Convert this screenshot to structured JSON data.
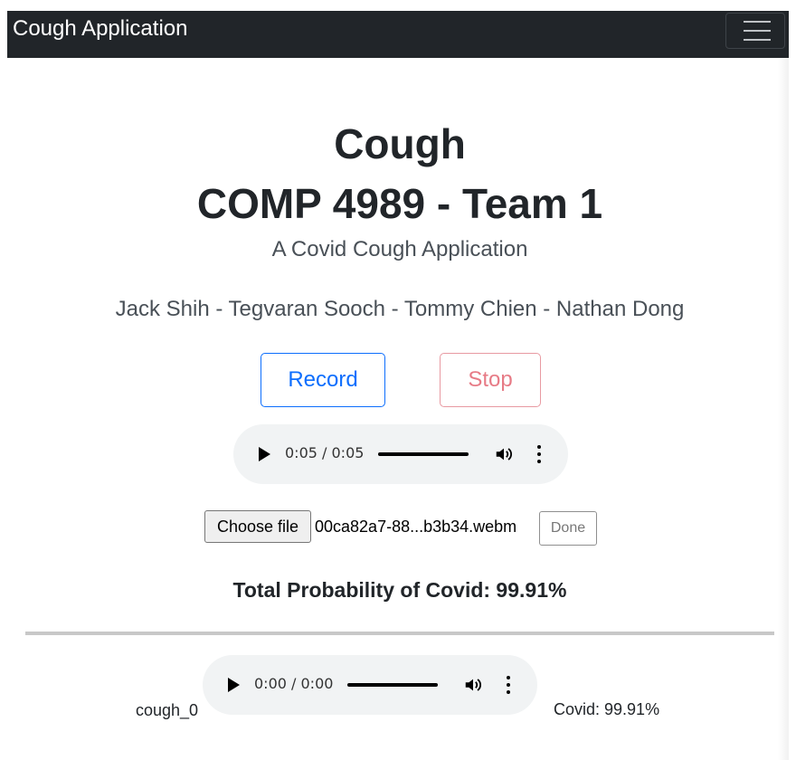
{
  "navbar": {
    "brand": "Cough Application",
    "menu_icon": "hamburger-menu-icon"
  },
  "header": {
    "title_line1": "Cough",
    "title_line2": "COMP 4989 - Team 1",
    "subtitle": "A Covid Cough Application",
    "members": "Jack Shih - Tegvaran Sooch - Tommy Chien - Nathan Dong"
  },
  "controls": {
    "record_label": "Record",
    "stop_label": "Stop",
    "record_color": "#0d6efd",
    "stop_color": "#e77b86"
  },
  "main_audio": {
    "time": "0:05 / 0:05",
    "progress": 1.0
  },
  "file": {
    "choose_label": "Choose file",
    "filename": "00ca82a7-88...b3b34.webm",
    "done_label": "Done"
  },
  "result": {
    "total_text": "Total Probability of Covid: 99.91%"
  },
  "samples": [
    {
      "name": "cough_0",
      "time": "0:00 / 0:00",
      "prediction": "Covid: 99.91%"
    }
  ]
}
